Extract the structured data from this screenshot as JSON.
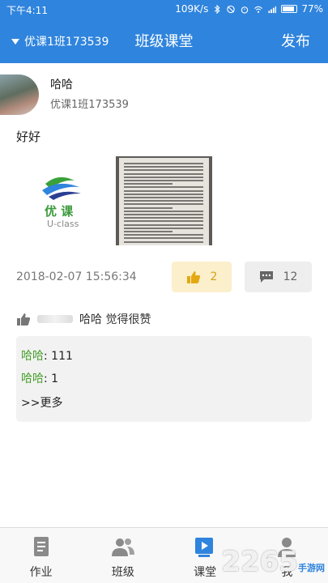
{
  "status_bar": {
    "time": "下午4:11",
    "network_speed": "109K/s",
    "battery": "77%"
  },
  "header": {
    "class_name": "优课1班173539",
    "title": "班级课堂",
    "publish_label": "发布"
  },
  "post": {
    "author_name": "哈哈",
    "author_class": "优课1班173539",
    "text": "好好",
    "logo_text_cn": "优 课",
    "logo_text_en": "U-class",
    "time": "2018-02-07 15:56:34",
    "like_count": "2",
    "comment_count": "12",
    "likers_text": "哈哈 觉得很赞",
    "comments": [
      {
        "name": "哈哈",
        "text": ": 111"
      },
      {
        "name": "哈哈",
        "text": ": 1"
      }
    ],
    "more_label": ">>更多"
  },
  "nav": {
    "items": [
      {
        "label": "作业",
        "icon": "homework-icon"
      },
      {
        "label": "班级",
        "icon": "class-people-icon"
      },
      {
        "label": "课堂",
        "icon": "classroom-icon",
        "active": true
      },
      {
        "label": "我",
        "icon": "profile-icon"
      }
    ]
  },
  "watermark": {
    "text": "2265",
    "sub": "手游网"
  },
  "colors": {
    "primary": "#2f84dd",
    "like_bg": "#fbefcc",
    "like_accent": "#d3a11c",
    "comment_name": "#46a02c"
  }
}
